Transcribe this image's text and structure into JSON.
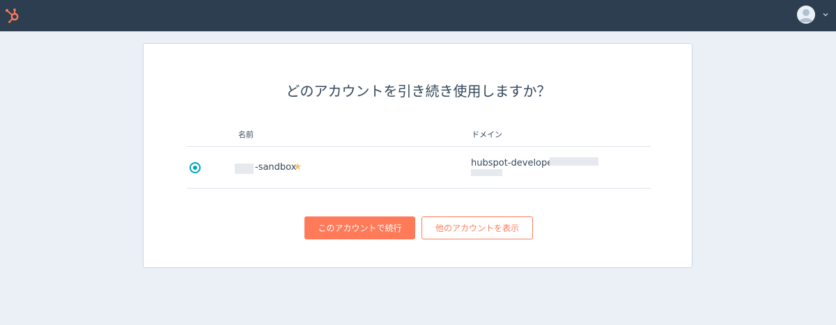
{
  "topbar": {
    "logo_icon": "hubspot-sprocket-icon",
    "avatar_icon": "user-avatar-icon",
    "menu_icon": "chevron-down-icon",
    "colors": {
      "background": "#2d3e50",
      "logo": "#ff7a59"
    }
  },
  "dialog": {
    "title": "どのアカウントを引き続き使用しますか？",
    "columns": {
      "name": "名前",
      "domain": "ドメイン"
    },
    "accounts": [
      {
        "name": "-sandbox",
        "starred": true,
        "star_icon": "star-icon",
        "domain": "hubspot-developers-",
        "selected": true
      }
    ],
    "buttons": {
      "continue": "このアカウントで続行",
      "show_other": "他のアカウントを表示"
    },
    "colors": {
      "accent": "#ff7a59",
      "radio": "#00a4bd",
      "star": "#f5c26b"
    }
  }
}
